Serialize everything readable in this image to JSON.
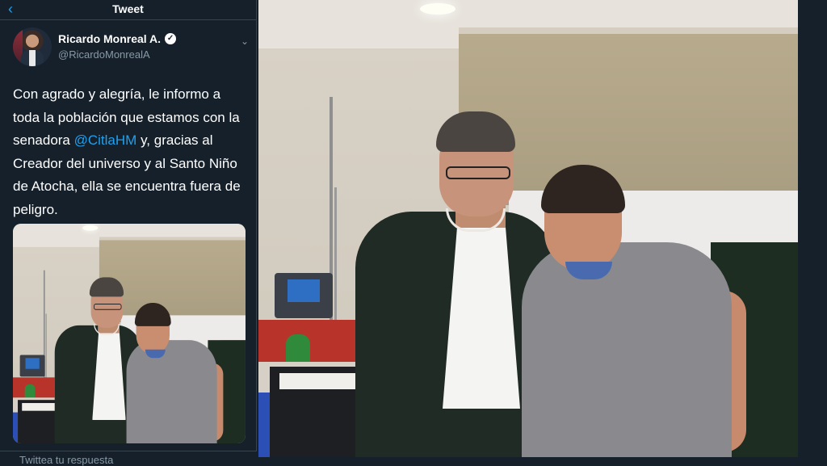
{
  "header": {
    "title": "Tweet",
    "back_icon": "arrow-left-icon"
  },
  "author": {
    "name": "Ricardo Monreal A.",
    "handle": "@RicardoMonrealA",
    "verified_icon": "verified-badge-icon",
    "menu_icon": "chevron-down-icon"
  },
  "tweet": {
    "text_before": "Con agrado y alegría, le informo a toda la población que estamos con la senadora ",
    "mention": "@CitlaHM",
    "text_after": " y, gracias al Creador del universo y al Santo Niño de Atocha, ella se encuentra fuera de peligro."
  },
  "reply": {
    "placeholder": "Twittea tu respuesta"
  },
  "colors": {
    "background": "#15202b",
    "accent": "#1da1f2",
    "muted": "#8899a6",
    "border": "#38444d"
  }
}
